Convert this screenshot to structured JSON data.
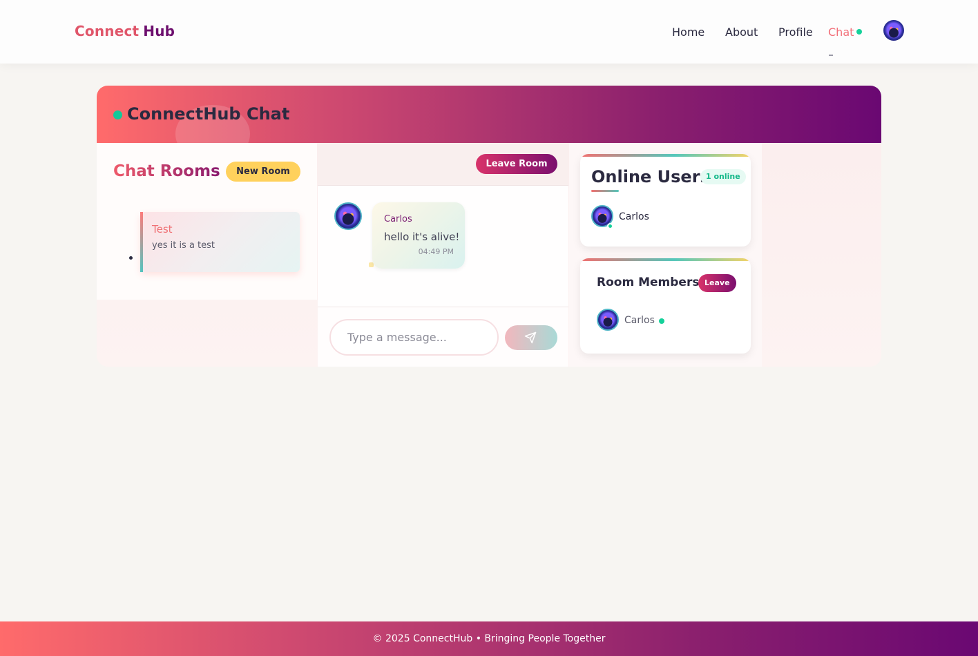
{
  "nav": {
    "brand_part1": "Connect",
    "brand_part2": "Hub",
    "links": [
      "Home",
      "About",
      "Profile",
      "Chat"
    ],
    "active_link": "Chat"
  },
  "header": {
    "title": "ConnectHub Chat"
  },
  "rooms": {
    "title": "Chat Rooms",
    "new_room_label": "New Room",
    "items": [
      {
        "name": "Test",
        "description": "yes it is a test"
      }
    ]
  },
  "messages": {
    "leave_room_label": "Leave Room",
    "items": [
      {
        "sender": "Carlos",
        "text": "hello it's alive!",
        "time": "04:49 PM"
      }
    ],
    "input_placeholder": "Type a message..."
  },
  "online_users": {
    "title": "Online Users",
    "badge": "1 online",
    "users": [
      {
        "name": "Carlos"
      }
    ]
  },
  "room_members": {
    "title": "Room Members",
    "leave_label": "Leave",
    "members": [
      {
        "name": "Carlos"
      }
    ]
  },
  "footer": {
    "text": "© 2025 ConnectHub • Bringing People Together"
  },
  "colors": {
    "accent_coral": "#ff6b6b",
    "accent_purple": "#6a0872",
    "online_green": "#15d19a",
    "button_yellow": "#ffd15c"
  }
}
